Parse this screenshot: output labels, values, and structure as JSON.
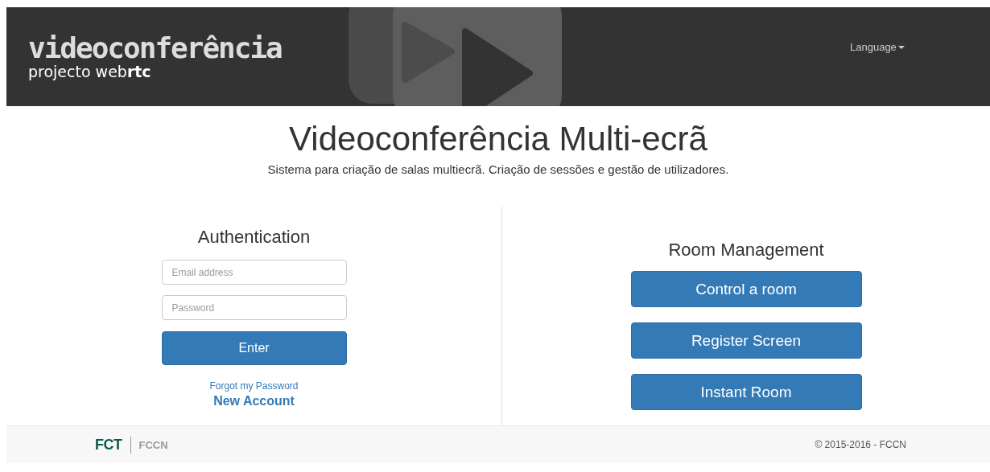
{
  "header": {
    "logo_title": "videoconferência",
    "logo_subtitle": "projecto web**rtc**",
    "language_menu": "Language"
  },
  "hero": {
    "title": "Videoconferência Multi-ecrã",
    "subtitle": "Sistema para criação de salas multiecrã. Criação de sessões e gestão de utilizadores."
  },
  "authentication": {
    "title": "Authentication",
    "fields": [
      {
        "placeholder": "Email address"
      },
      {
        "placeholder": "Password"
      }
    ],
    "button": "Enter",
    "links": [
      {
        "label": "Forgot my Password",
        "kind": "small"
      },
      {
        "label": "New Account",
        "kind": "strong"
      }
    ]
  },
  "room_management": {
    "title": "Room Management",
    "buttons": [
      "Control a room",
      "Register Screen",
      "Instant Room"
    ]
  },
  "footer": {
    "logos": [
      "FCT",
      "FCCN"
    ],
    "copyright": "© 2015-2016 - FCCN"
  }
}
